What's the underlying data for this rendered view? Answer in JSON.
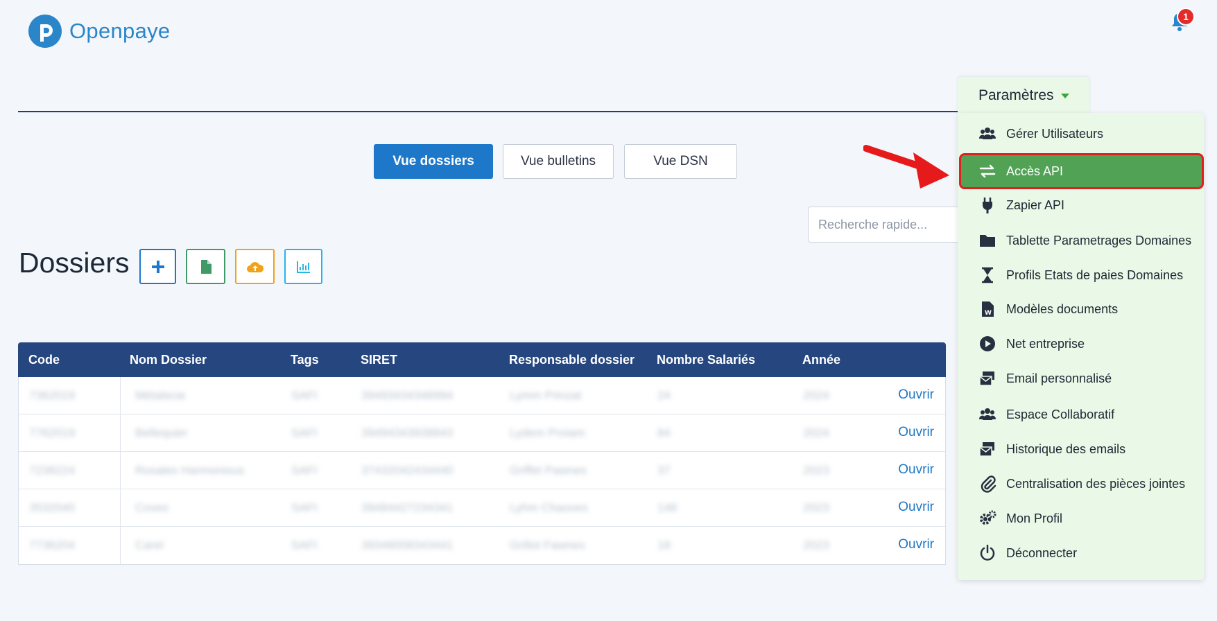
{
  "app": {
    "name": "Openpaye"
  },
  "notifications": {
    "count": "1"
  },
  "views": {
    "dossiers": "Vue dossiers",
    "bulletins": "Vue bulletins",
    "dsn": "Vue DSN"
  },
  "search": {
    "placeholder": "Recherche rapide..."
  },
  "page": {
    "title": "Dossiers"
  },
  "toolbar": {
    "icons": [
      "plus-icon",
      "file-icon",
      "cloud-upload-icon",
      "chart-icon"
    ]
  },
  "table": {
    "headers": [
      "Code",
      "Nom Dossier",
      "Tags",
      "SIRET",
      "Responsable dossier",
      "Nombre Salariés",
      "Année"
    ],
    "rows": [
      {
        "code": "7362019",
        "nom": "Métalecie",
        "tags": "SAFI",
        "siret": "39493434348994",
        "responsable": "Lymm Prinzat",
        "salaries": "24",
        "annee": "2024",
        "action": "Ouvrir"
      },
      {
        "code": "7762019",
        "nom": "Bellequier",
        "tags": "SAFI",
        "siret": "39494343938843",
        "responsable": "Lydem Proiam",
        "salaries": "84",
        "annee": "2024",
        "action": "Ouvrir"
      },
      {
        "code": "7238224",
        "nom": "Rosales Harmonious",
        "tags": "SAFI",
        "siret": "37432042434440",
        "responsable": "Griffet Pawnes",
        "salaries": "37",
        "annee": "2023",
        "action": "Ouvrir"
      },
      {
        "code": "3532040",
        "nom": "Coves",
        "tags": "SAFI",
        "siret": "39484427234341",
        "responsable": "Lyhm Chaoves",
        "salaries": "148",
        "annee": "2023",
        "action": "Ouvrir"
      },
      {
        "code": "7736204",
        "nom": "Carel",
        "tags": "SAFI",
        "siret": "39348008343441",
        "responsable": "Grillot Fawnes",
        "salaries": "18",
        "annee": "2023",
        "action": "Ouvrir"
      }
    ]
  },
  "settings_menu": {
    "toggle_label": "Paramètres",
    "items": [
      {
        "label": "Gérer Utilisateurs",
        "icon": "users-icon"
      },
      {
        "label": "Accès API",
        "icon": "exchange-arrows-icon"
      },
      {
        "label": "Zapier API",
        "icon": "plug-icon"
      },
      {
        "label": "Tablette Parametrages Domaines",
        "icon": "folder-icon"
      },
      {
        "label": "Profils Etats de paies Domaines",
        "icon": "hourglass-icon"
      },
      {
        "label": "Modèles documents",
        "icon": "word-document-icon"
      },
      {
        "label": "Net entreprise",
        "icon": "play-circle-icon"
      },
      {
        "label": "Email personnalisé",
        "icon": "email-stack-icon"
      },
      {
        "label": "Espace Collaboratif",
        "icon": "users-icon"
      },
      {
        "label": "Historique des emails",
        "icon": "email-stack-icon"
      },
      {
        "label": "Centralisation des pièces jointes",
        "icon": "paperclip-icon"
      },
      {
        "label": "Mon Profil",
        "icon": "gears-icon"
      },
      {
        "label": "Déconnecter",
        "icon": "power-icon"
      }
    ]
  },
  "colors": {
    "brand": "#2a86c9",
    "table_header": "#26467f",
    "menu_background": "#eaf8e7",
    "menu_highlight": "#52a256",
    "highlight_border": "#e01f1f"
  }
}
